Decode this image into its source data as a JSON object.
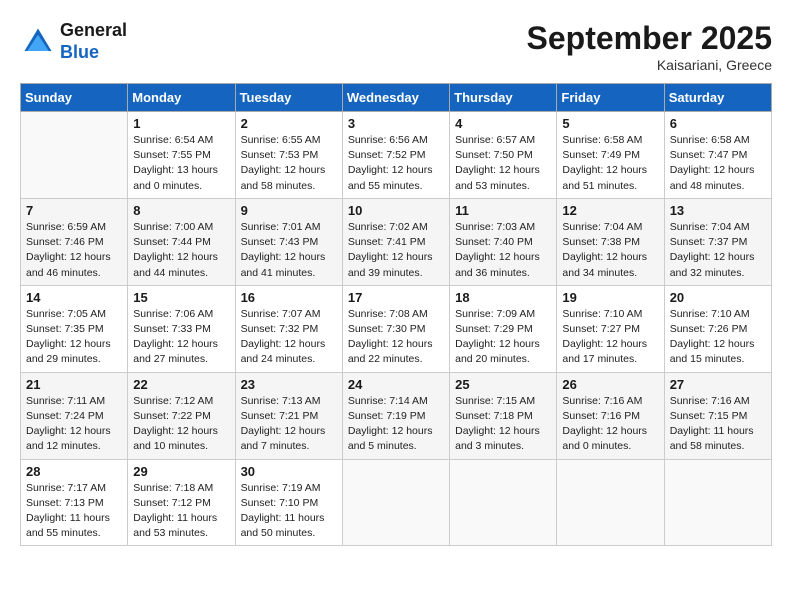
{
  "header": {
    "logo_general": "General",
    "logo_blue": "Blue",
    "month_title": "September 2025",
    "location": "Kaisariani, Greece"
  },
  "weekdays": [
    "Sunday",
    "Monday",
    "Tuesday",
    "Wednesday",
    "Thursday",
    "Friday",
    "Saturday"
  ],
  "weeks": [
    [
      {
        "day": null,
        "sunrise": null,
        "sunset": null,
        "daylight": null
      },
      {
        "day": "1",
        "sunrise": "Sunrise: 6:54 AM",
        "sunset": "Sunset: 7:55 PM",
        "daylight": "Daylight: 13 hours and 0 minutes."
      },
      {
        "day": "2",
        "sunrise": "Sunrise: 6:55 AM",
        "sunset": "Sunset: 7:53 PM",
        "daylight": "Daylight: 12 hours and 58 minutes."
      },
      {
        "day": "3",
        "sunrise": "Sunrise: 6:56 AM",
        "sunset": "Sunset: 7:52 PM",
        "daylight": "Daylight: 12 hours and 55 minutes."
      },
      {
        "day": "4",
        "sunrise": "Sunrise: 6:57 AM",
        "sunset": "Sunset: 7:50 PM",
        "daylight": "Daylight: 12 hours and 53 minutes."
      },
      {
        "day": "5",
        "sunrise": "Sunrise: 6:58 AM",
        "sunset": "Sunset: 7:49 PM",
        "daylight": "Daylight: 12 hours and 51 minutes."
      },
      {
        "day": "6",
        "sunrise": "Sunrise: 6:58 AM",
        "sunset": "Sunset: 7:47 PM",
        "daylight": "Daylight: 12 hours and 48 minutes."
      }
    ],
    [
      {
        "day": "7",
        "sunrise": "Sunrise: 6:59 AM",
        "sunset": "Sunset: 7:46 PM",
        "daylight": "Daylight: 12 hours and 46 minutes."
      },
      {
        "day": "8",
        "sunrise": "Sunrise: 7:00 AM",
        "sunset": "Sunset: 7:44 PM",
        "daylight": "Daylight: 12 hours and 44 minutes."
      },
      {
        "day": "9",
        "sunrise": "Sunrise: 7:01 AM",
        "sunset": "Sunset: 7:43 PM",
        "daylight": "Daylight: 12 hours and 41 minutes."
      },
      {
        "day": "10",
        "sunrise": "Sunrise: 7:02 AM",
        "sunset": "Sunset: 7:41 PM",
        "daylight": "Daylight: 12 hours and 39 minutes."
      },
      {
        "day": "11",
        "sunrise": "Sunrise: 7:03 AM",
        "sunset": "Sunset: 7:40 PM",
        "daylight": "Daylight: 12 hours and 36 minutes."
      },
      {
        "day": "12",
        "sunrise": "Sunrise: 7:04 AM",
        "sunset": "Sunset: 7:38 PM",
        "daylight": "Daylight: 12 hours and 34 minutes."
      },
      {
        "day": "13",
        "sunrise": "Sunrise: 7:04 AM",
        "sunset": "Sunset: 7:37 PM",
        "daylight": "Daylight: 12 hours and 32 minutes."
      }
    ],
    [
      {
        "day": "14",
        "sunrise": "Sunrise: 7:05 AM",
        "sunset": "Sunset: 7:35 PM",
        "daylight": "Daylight: 12 hours and 29 minutes."
      },
      {
        "day": "15",
        "sunrise": "Sunrise: 7:06 AM",
        "sunset": "Sunset: 7:33 PM",
        "daylight": "Daylight: 12 hours and 27 minutes."
      },
      {
        "day": "16",
        "sunrise": "Sunrise: 7:07 AM",
        "sunset": "Sunset: 7:32 PM",
        "daylight": "Daylight: 12 hours and 24 minutes."
      },
      {
        "day": "17",
        "sunrise": "Sunrise: 7:08 AM",
        "sunset": "Sunset: 7:30 PM",
        "daylight": "Daylight: 12 hours and 22 minutes."
      },
      {
        "day": "18",
        "sunrise": "Sunrise: 7:09 AM",
        "sunset": "Sunset: 7:29 PM",
        "daylight": "Daylight: 12 hours and 20 minutes."
      },
      {
        "day": "19",
        "sunrise": "Sunrise: 7:10 AM",
        "sunset": "Sunset: 7:27 PM",
        "daylight": "Daylight: 12 hours and 17 minutes."
      },
      {
        "day": "20",
        "sunrise": "Sunrise: 7:10 AM",
        "sunset": "Sunset: 7:26 PM",
        "daylight": "Daylight: 12 hours and 15 minutes."
      }
    ],
    [
      {
        "day": "21",
        "sunrise": "Sunrise: 7:11 AM",
        "sunset": "Sunset: 7:24 PM",
        "daylight": "Daylight: 12 hours and 12 minutes."
      },
      {
        "day": "22",
        "sunrise": "Sunrise: 7:12 AM",
        "sunset": "Sunset: 7:22 PM",
        "daylight": "Daylight: 12 hours and 10 minutes."
      },
      {
        "day": "23",
        "sunrise": "Sunrise: 7:13 AM",
        "sunset": "Sunset: 7:21 PM",
        "daylight": "Daylight: 12 hours and 7 minutes."
      },
      {
        "day": "24",
        "sunrise": "Sunrise: 7:14 AM",
        "sunset": "Sunset: 7:19 PM",
        "daylight": "Daylight: 12 hours and 5 minutes."
      },
      {
        "day": "25",
        "sunrise": "Sunrise: 7:15 AM",
        "sunset": "Sunset: 7:18 PM",
        "daylight": "Daylight: 12 hours and 3 minutes."
      },
      {
        "day": "26",
        "sunrise": "Sunrise: 7:16 AM",
        "sunset": "Sunset: 7:16 PM",
        "daylight": "Daylight: 12 hours and 0 minutes."
      },
      {
        "day": "27",
        "sunrise": "Sunrise: 7:16 AM",
        "sunset": "Sunset: 7:15 PM",
        "daylight": "Daylight: 11 hours and 58 minutes."
      }
    ],
    [
      {
        "day": "28",
        "sunrise": "Sunrise: 7:17 AM",
        "sunset": "Sunset: 7:13 PM",
        "daylight": "Daylight: 11 hours and 55 minutes."
      },
      {
        "day": "29",
        "sunrise": "Sunrise: 7:18 AM",
        "sunset": "Sunset: 7:12 PM",
        "daylight": "Daylight: 11 hours and 53 minutes."
      },
      {
        "day": "30",
        "sunrise": "Sunrise: 7:19 AM",
        "sunset": "Sunset: 7:10 PM",
        "daylight": "Daylight: 11 hours and 50 minutes."
      },
      {
        "day": null,
        "sunrise": null,
        "sunset": null,
        "daylight": null
      },
      {
        "day": null,
        "sunrise": null,
        "sunset": null,
        "daylight": null
      },
      {
        "day": null,
        "sunrise": null,
        "sunset": null,
        "daylight": null
      },
      {
        "day": null,
        "sunrise": null,
        "sunset": null,
        "daylight": null
      }
    ]
  ]
}
